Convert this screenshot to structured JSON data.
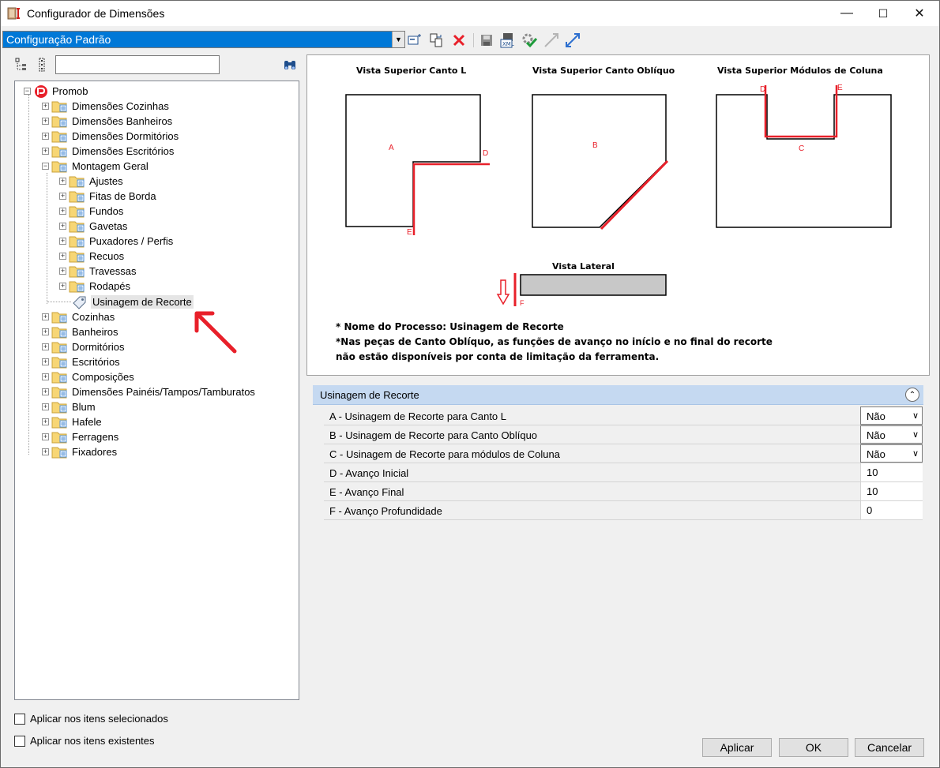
{
  "window": {
    "title": "Configurador de Dimensões",
    "controls": [
      "—",
      "☐",
      "✕"
    ]
  },
  "toolbar": {
    "config_value": "Configuração Padrão"
  },
  "tree": {
    "root": "Promob",
    "items": [
      "Dimensões Cozinhas",
      "Dimensões Banheiros",
      "Dimensões Dormitórios",
      "Dimensões Escritórios",
      "Montagem Geral",
      "Ajustes",
      "Fitas de Borda",
      "Fundos",
      "Gavetas",
      "Puxadores / Perfis",
      "Recuos",
      "Travessas",
      "Rodapés",
      "Usinagem de Recorte",
      "Cozinhas",
      "Banheiros",
      "Dormitórios",
      "Escritórios",
      "Composições",
      "Dimensões Painéis/Tampos/Tamburatos",
      "Blum",
      "Hafele",
      "Ferragens",
      "Fixadores"
    ]
  },
  "preview": {
    "title_l": "Vista Superior Canto L",
    "title_oblique": "Vista Superior Canto Oblíquo",
    "title_column": "Vista Superior Módulos de Coluna",
    "title_lateral": "Vista Lateral",
    "labels": {
      "a": "A",
      "b": "B",
      "c": "C",
      "d": "D",
      "e": "E",
      "f": "F"
    },
    "note1": "* Nome do Processo: Usinagem de Recorte",
    "note2": "*Nas peças de Canto Oblíquo, as funções de avanço no início e no final do recorte",
    "note3": "não estão disponíveis por conta de limitação da ferramenta."
  },
  "properties": {
    "header": "Usinagem de Recorte",
    "rows": [
      {
        "label": "A -  Usinagem de Recorte para Canto L",
        "value": "Não"
      },
      {
        "label": "B -  Usinagem de Recorte para Canto Oblíquo",
        "value": "Não"
      },
      {
        "label": "C -  Usinagem de Recorte para módulos de Coluna",
        "value": "Não"
      },
      {
        "label": "D -  Avanço Inicial",
        "value": "10"
      },
      {
        "label": "E -  Avanço Final",
        "value": "10"
      },
      {
        "label": "F -  Avanço Profundidade",
        "value": "0"
      }
    ]
  },
  "footer": {
    "check1": "Aplicar nos itens selecionados",
    "check2": "Aplicar nos itens existentes",
    "apply": "Aplicar",
    "ok": "OK",
    "cancel": "Cancelar"
  },
  "colors": {
    "accent": "#0078d7",
    "red": "#e8202a",
    "header_blue": "#c5d9f1"
  }
}
